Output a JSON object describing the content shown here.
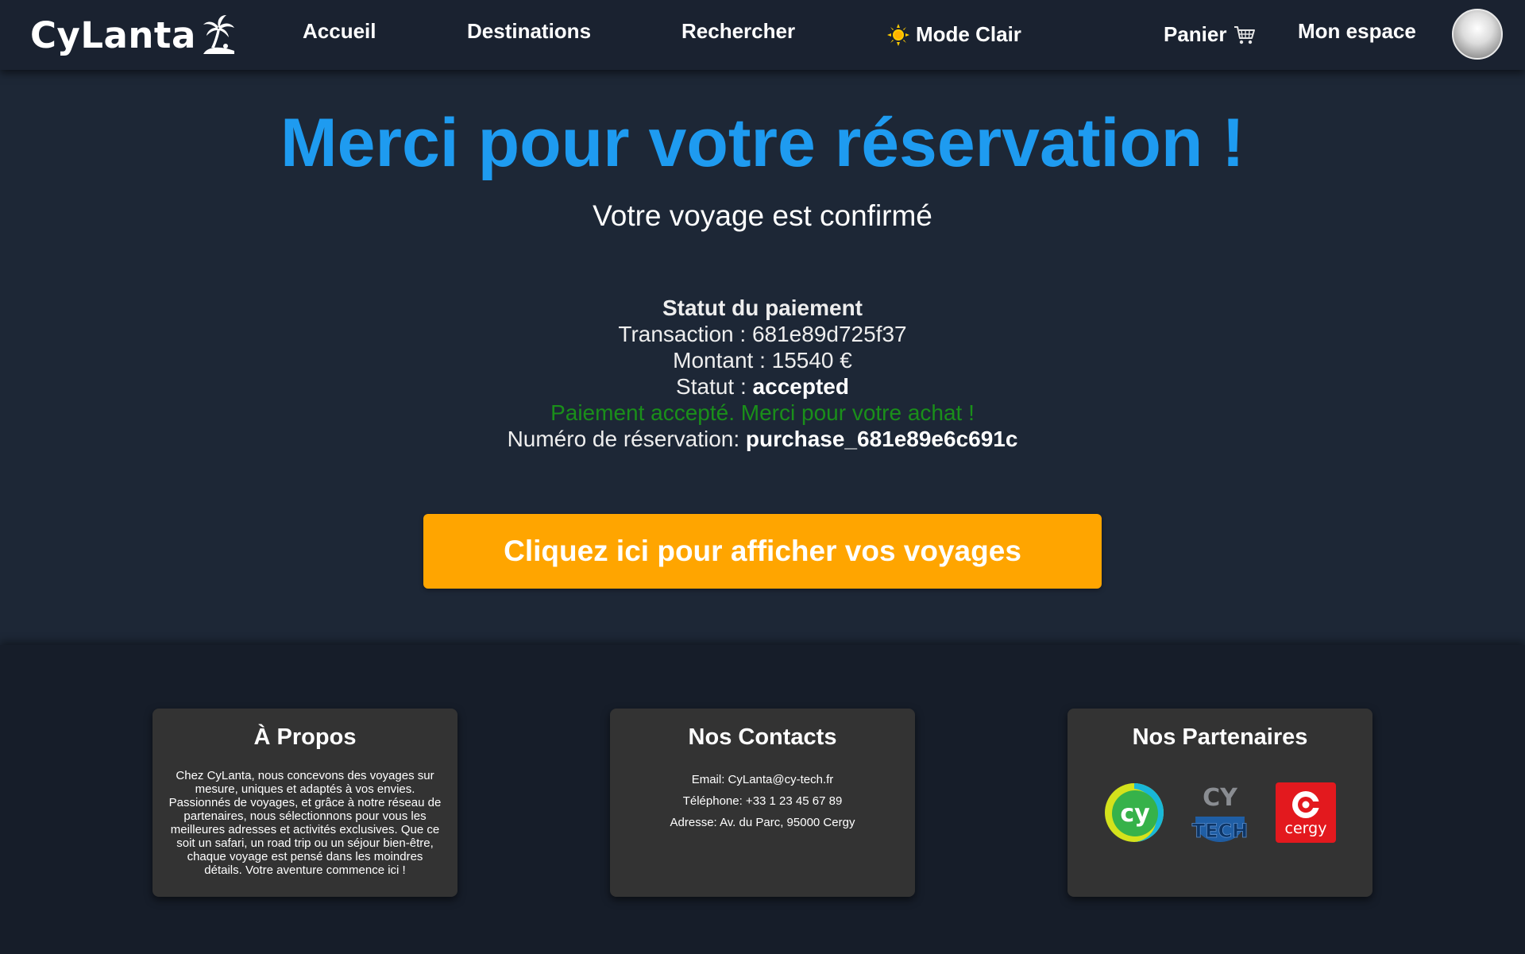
{
  "navbar": {
    "logo_text": "CyLanta",
    "logo_icon": "palm-island-icon",
    "links": {
      "accueil": "Accueil",
      "destinations": "Destinations",
      "rechercher": "Rechercher",
      "mode": "Mode Clair",
      "panier": "Panier",
      "espace": "Mon espace"
    },
    "mode_icon": "sun-icon",
    "cart_icon": "cart-icon"
  },
  "main": {
    "title": "Merci pour votre réservation !",
    "subtitle": "Votre voyage est confirmé",
    "payment": {
      "heading": "Statut du paiement",
      "transaction_label": "Transaction : ",
      "transaction_value": "681e89d725f37",
      "amount_label": "Montant : ",
      "amount_value": "15540 €",
      "status_label": "Statut : ",
      "status_value": "accepted",
      "success_message": "Paiement accepté. Merci pour votre achat !",
      "reservation_label": "Numéro de réservation: ",
      "reservation_value": "purchase_681e89e6c691c"
    },
    "cta_label": "Cliquez ici pour afficher vos voyages"
  },
  "footer": {
    "about": {
      "title": "À Propos",
      "text": "Chez CyLanta, nous concevons des voyages sur mesure, uniques et adaptés à vos envies. Passionnés de voyages, et grâce à notre réseau de partenaires, nous sélectionnons pour vous les meilleures adresses et activités exclusives. Que ce soit un safari, un road trip ou un séjour bien-être, chaque voyage est pensé dans les moindres détails. Votre aventure commence ici !"
    },
    "contacts": {
      "title": "Nos Contacts",
      "email": "Email: CyLanta@cy-tech.fr",
      "phone": "Téléphone: +33 1 23 45 67 89",
      "address": "Adresse: Av. du Parc, 95000 Cergy"
    },
    "partners": {
      "title": "Nos Partenaires",
      "logos": [
        {
          "name": "cy-logo",
          "text": "cy"
        },
        {
          "name": "cy-tech-logo",
          "text": "CY TECH"
        },
        {
          "name": "cergy-logo",
          "text": "cergy"
        }
      ]
    }
  },
  "colors": {
    "background": "#1d2736",
    "navbar": "#1a2230",
    "title_blue": "#1e9bf0",
    "success_green": "#1a8f1a",
    "cta_orange": "#ffa500",
    "footer": "#161d29",
    "card": "#333333"
  }
}
